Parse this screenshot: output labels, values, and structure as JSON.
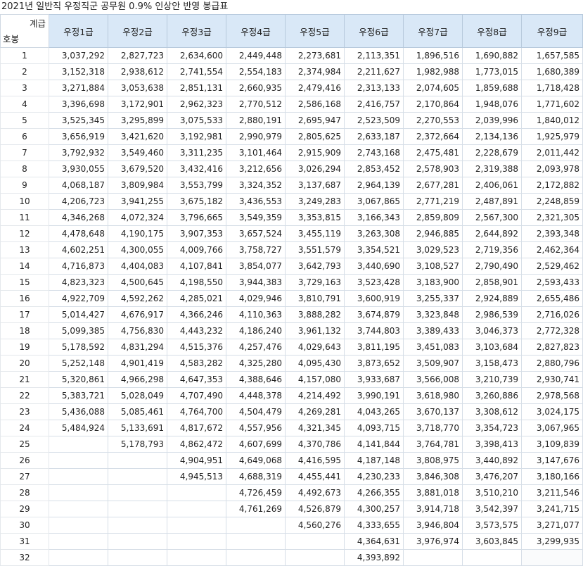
{
  "title": "2021년 일반직 우정직군 공무원 0.9% 인상안 반영 봉급표",
  "header": {
    "corner_grade": "계급",
    "corner_step": "호봉",
    "grades": [
      "우정1급",
      "우정2급",
      "우정3급",
      "우정4급",
      "우정5급",
      "우정6급",
      "우정7급",
      "우정8급",
      "우정9급"
    ]
  },
  "rows": [
    {
      "step": "1",
      "values": [
        "3,037,292",
        "2,827,723",
        "2,634,600",
        "2,449,448",
        "2,273,681",
        "2,113,351",
        "1,896,516",
        "1,690,882",
        "1,657,585"
      ]
    },
    {
      "step": "2",
      "values": [
        "3,152,318",
        "2,938,612",
        "2,741,554",
        "2,554,183",
        "2,374,984",
        "2,211,627",
        "1,982,988",
        "1,773,015",
        "1,680,389"
      ]
    },
    {
      "step": "3",
      "values": [
        "3,271,884",
        "3,053,638",
        "2,851,131",
        "2,660,935",
        "2,479,416",
        "2,313,133",
        "2,074,605",
        "1,859,688",
        "1,718,428"
      ]
    },
    {
      "step": "4",
      "values": [
        "3,396,698",
        "3,172,901",
        "2,962,323",
        "2,770,512",
        "2,586,168",
        "2,416,757",
        "2,170,864",
        "1,948,076",
        "1,771,602"
      ]
    },
    {
      "step": "5",
      "values": [
        "3,525,345",
        "3,295,899",
        "3,075,533",
        "2,880,191",
        "2,695,947",
        "2,523,509",
        "2,270,553",
        "2,039,996",
        "1,840,012"
      ]
    },
    {
      "step": "6",
      "values": [
        "3,656,919",
        "3,421,620",
        "3,192,981",
        "2,990,979",
        "2,805,625",
        "2,633,187",
        "2,372,664",
        "2,134,136",
        "1,925,979"
      ]
    },
    {
      "step": "7",
      "values": [
        "3,792,932",
        "3,549,460",
        "3,311,235",
        "3,101,464",
        "2,915,909",
        "2,743,168",
        "2,475,481",
        "2,228,679",
        "2,011,442"
      ]
    },
    {
      "step": "8",
      "values": [
        "3,930,055",
        "3,679,520",
        "3,432,416",
        "3,212,656",
        "3,026,294",
        "2,853,452",
        "2,578,903",
        "2,319,388",
        "2,093,978"
      ]
    },
    {
      "step": "9",
      "values": [
        "4,068,187",
        "3,809,984",
        "3,553,799",
        "3,324,352",
        "3,137,687",
        "2,964,139",
        "2,677,281",
        "2,406,061",
        "2,172,882"
      ]
    },
    {
      "step": "10",
      "values": [
        "4,206,723",
        "3,941,255",
        "3,675,182",
        "3,436,553",
        "3,249,283",
        "3,067,865",
        "2,771,219",
        "2,487,891",
        "2,248,859"
      ]
    },
    {
      "step": "11",
      "values": [
        "4,346,268",
        "4,072,324",
        "3,796,665",
        "3,549,359",
        "3,353,815",
        "3,166,343",
        "2,859,809",
        "2,567,300",
        "2,321,305"
      ]
    },
    {
      "step": "12",
      "values": [
        "4,478,648",
        "4,190,175",
        "3,907,353",
        "3,657,524",
        "3,455,119",
        "3,263,308",
        "2,946,885",
        "2,644,892",
        "2,393,348"
      ]
    },
    {
      "step": "13",
      "values": [
        "4,602,251",
        "4,300,055",
        "4,009,766",
        "3,758,727",
        "3,551,579",
        "3,354,521",
        "3,029,523",
        "2,719,356",
        "2,462,364"
      ]
    },
    {
      "step": "14",
      "values": [
        "4,716,873",
        "4,404,083",
        "4,107,841",
        "3,854,077",
        "3,642,793",
        "3,440,690",
        "3,108,527",
        "2,790,490",
        "2,529,462"
      ]
    },
    {
      "step": "15",
      "values": [
        "4,823,323",
        "4,500,645",
        "4,198,550",
        "3,944,383",
        "3,729,163",
        "3,523,428",
        "3,183,900",
        "2,858,901",
        "2,593,433"
      ]
    },
    {
      "step": "16",
      "values": [
        "4,922,709",
        "4,592,262",
        "4,285,021",
        "4,029,946",
        "3,810,791",
        "3,600,919",
        "3,255,337",
        "2,924,889",
        "2,655,486"
      ]
    },
    {
      "step": "17",
      "values": [
        "5,014,427",
        "4,676,917",
        "4,366,246",
        "4,110,363",
        "3,888,282",
        "3,674,879",
        "3,323,848",
        "2,986,539",
        "2,716,026"
      ]
    },
    {
      "step": "18",
      "values": [
        "5,099,385",
        "4,756,830",
        "4,443,232",
        "4,186,240",
        "3,961,132",
        "3,744,803",
        "3,389,433",
        "3,046,373",
        "2,772,328"
      ]
    },
    {
      "step": "19",
      "values": [
        "5,178,592",
        "4,831,294",
        "4,515,376",
        "4,257,476",
        "4,029,643",
        "3,811,195",
        "3,451,083",
        "3,103,684",
        "2,827,823"
      ]
    },
    {
      "step": "20",
      "values": [
        "5,252,148",
        "4,901,419",
        "4,583,282",
        "4,325,280",
        "4,095,430",
        "3,873,652",
        "3,509,907",
        "3,158,473",
        "2,880,796"
      ]
    },
    {
      "step": "21",
      "values": [
        "5,320,861",
        "4,966,298",
        "4,647,353",
        "4,388,646",
        "4,157,080",
        "3,933,687",
        "3,566,008",
        "3,210,739",
        "2,930,741"
      ]
    },
    {
      "step": "22",
      "values": [
        "5,383,721",
        "5,028,049",
        "4,707,490",
        "4,448,378",
        "4,214,492",
        "3,990,191",
        "3,618,980",
        "3,260,886",
        "2,978,568"
      ]
    },
    {
      "step": "23",
      "values": [
        "5,436,088",
        "5,085,461",
        "4,764,700",
        "4,504,479",
        "4,269,281",
        "4,043,265",
        "3,670,137",
        "3,308,612",
        "3,024,175"
      ]
    },
    {
      "step": "24",
      "values": [
        "5,484,924",
        "5,133,691",
        "4,817,672",
        "4,557,956",
        "4,321,345",
        "4,093,715",
        "3,718,770",
        "3,354,723",
        "3,067,965"
      ]
    },
    {
      "step": "25",
      "values": [
        "",
        "5,178,793",
        "4,862,472",
        "4,607,699",
        "4,370,786",
        "4,141,844",
        "3,764,781",
        "3,398,413",
        "3,109,839"
      ]
    },
    {
      "step": "26",
      "values": [
        "",
        "",
        "4,904,951",
        "4,649,068",
        "4,416,595",
        "4,187,148",
        "3,808,975",
        "3,440,892",
        "3,147,676"
      ]
    },
    {
      "step": "27",
      "values": [
        "",
        "",
        "4,945,513",
        "4,688,319",
        "4,455,441",
        "4,230,233",
        "3,846,308",
        "3,476,207",
        "3,180,166"
      ]
    },
    {
      "step": "28",
      "values": [
        "",
        "",
        "",
        "4,726,459",
        "4,492,673",
        "4,266,355",
        "3,881,018",
        "3,510,210",
        "3,211,546"
      ]
    },
    {
      "step": "29",
      "values": [
        "",
        "",
        "",
        "4,761,269",
        "4,526,879",
        "4,300,257",
        "3,914,718",
        "3,542,397",
        "3,241,715"
      ]
    },
    {
      "step": "30",
      "values": [
        "",
        "",
        "",
        "",
        "4,560,276",
        "4,333,655",
        "3,946,804",
        "3,573,575",
        "3,271,077"
      ]
    },
    {
      "step": "31",
      "values": [
        "",
        "",
        "",
        "",
        "",
        "4,364,631",
        "3,976,974",
        "3,603,845",
        "3,299,935"
      ]
    },
    {
      "step": "32",
      "values": [
        "",
        "",
        "",
        "",
        "",
        "4,393,892",
        "",
        "",
        ""
      ]
    }
  ]
}
